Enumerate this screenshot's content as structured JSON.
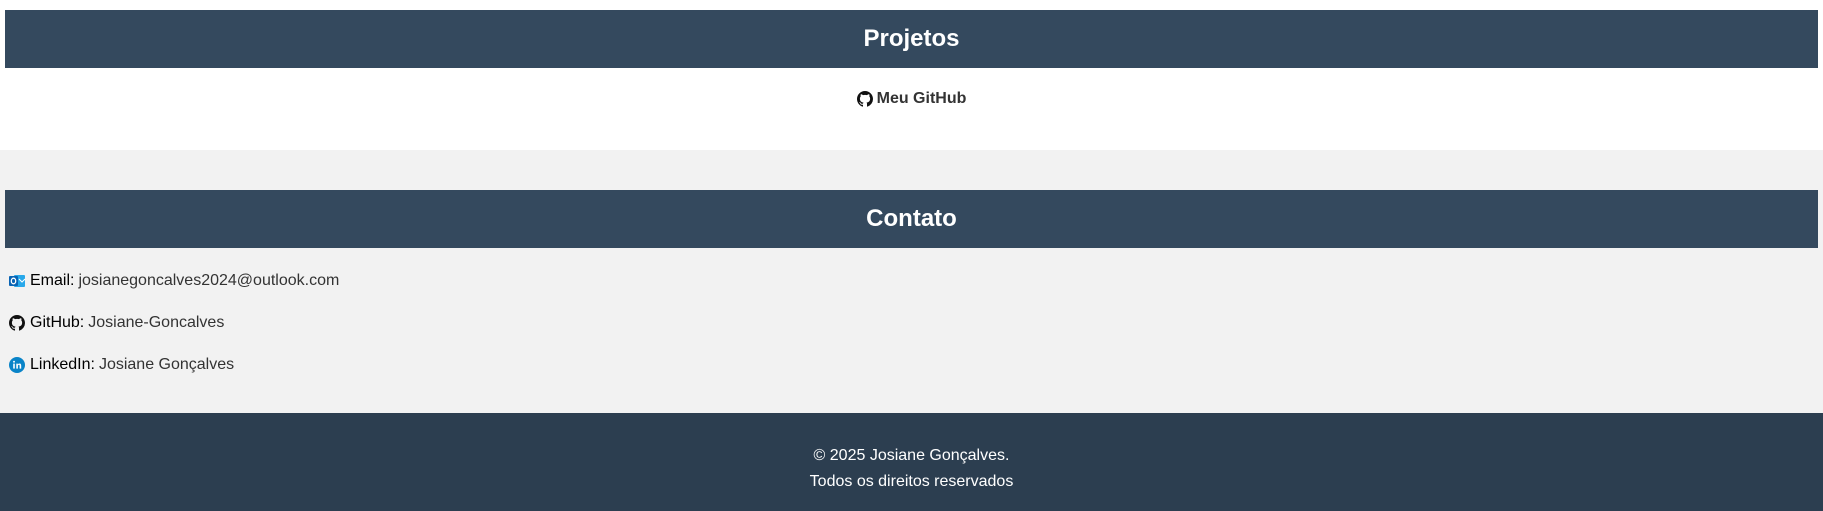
{
  "projects": {
    "title": "Projetos",
    "github_link_label": "Meu GitHub"
  },
  "contact": {
    "title": "Contato",
    "items": [
      {
        "icon": "outlook-icon",
        "label": "Email:",
        "value": "josianegoncalves2024@outlook.com"
      },
      {
        "icon": "github-icon",
        "label": "GitHub:",
        "value": "Josiane-Goncalves"
      },
      {
        "icon": "linkedin-icon",
        "label": "LinkedIn:",
        "value": "Josiane Gonçalves"
      }
    ]
  },
  "footer": {
    "copyright": "© 2025 Josiane Gonçalves.",
    "rights": "Todos os direitos reservados"
  },
  "colors": {
    "header_bg": "#34495e",
    "footer_bg": "#2c3e50",
    "page_bg": "#f2f2f2",
    "outlook_blue": "#0a64b4",
    "linkedin_blue": "#0a84c8"
  }
}
